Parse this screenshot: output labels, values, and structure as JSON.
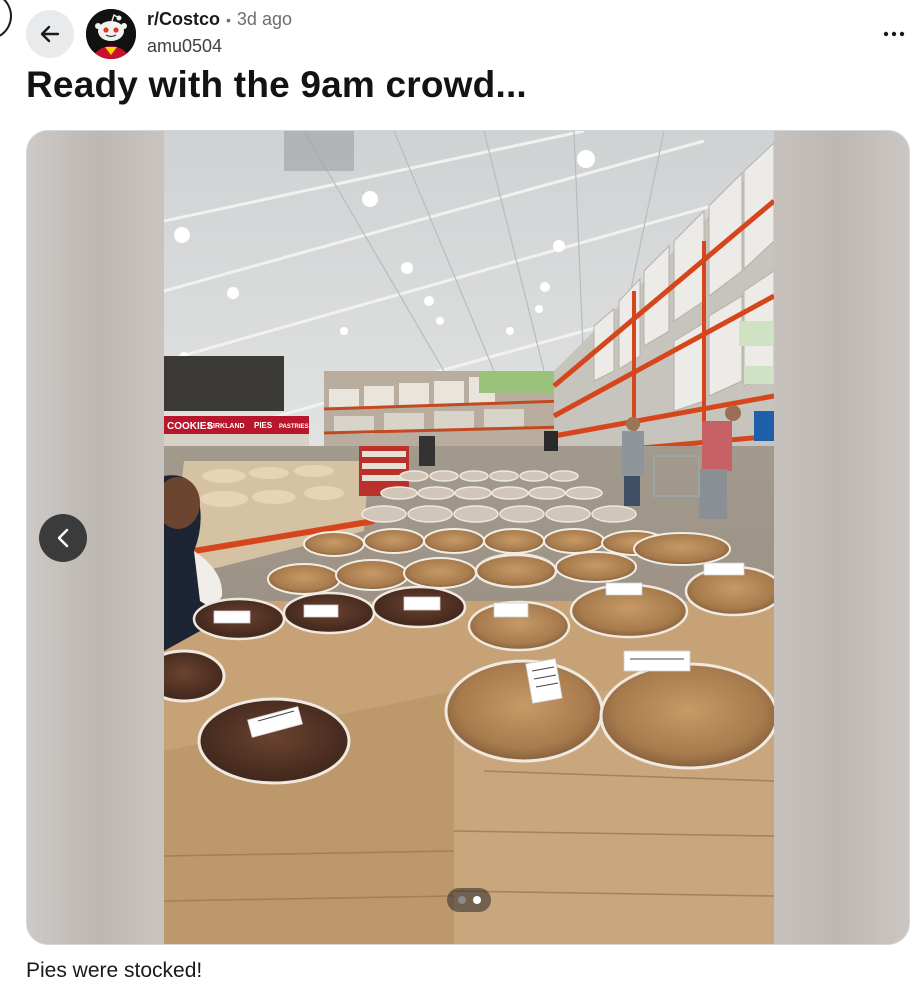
{
  "post": {
    "subreddit": "r/Costco",
    "separator": "•",
    "age": "3d ago",
    "author": "amu0504",
    "title": "Ready with the 9am crowd...",
    "body": "Pies were stocked!"
  },
  "gallery": {
    "total_images": 2,
    "current_index": 2,
    "signage": {
      "left_sign": "COOKIES",
      "middle_sign": "KIRKLAND",
      "right_sign": "PIES",
      "far_sign": "PASTRIES"
    }
  },
  "icons": {
    "back": "arrow-left-icon",
    "more": "more-horizontal-icon",
    "prev": "chevron-left-icon",
    "avatar": "snoo-avatar-icon"
  },
  "colors": {
    "text_primary": "#1a1a1b",
    "text_secondary": "#6b6f73",
    "back_button_bg": "#e9eaec",
    "nav_button_bg": "#3b3b3b"
  }
}
